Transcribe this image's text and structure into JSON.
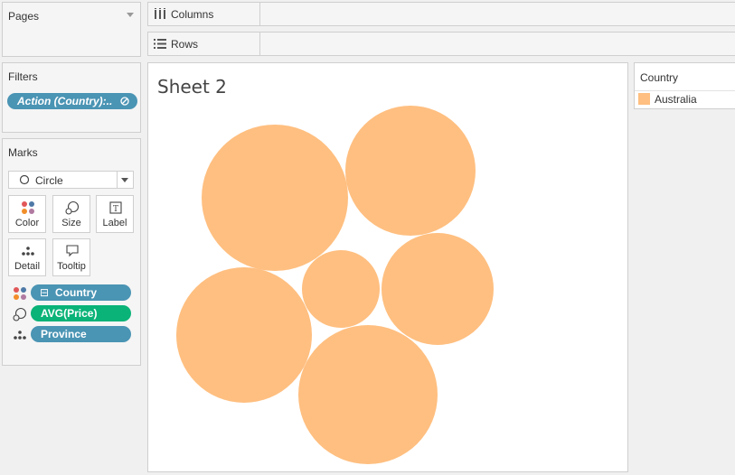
{
  "pages": {
    "title": "Pages"
  },
  "filters": {
    "title": "Filters",
    "pill_label": "Action (Country):.."
  },
  "marks": {
    "title": "Marks",
    "mark_type": "Circle",
    "buttons": {
      "color": "Color",
      "size": "Size",
      "label": "Label",
      "detail": "Detail",
      "tooltip": "Tooltip"
    },
    "cards": [
      {
        "label": "Country",
        "encoding": "color-icon",
        "prefix": "⊟"
      },
      {
        "label": "AVG(Price)",
        "encoding": "size-icon"
      },
      {
        "label": "Province",
        "encoding": "detail-icon"
      }
    ]
  },
  "shelves": {
    "columns": "Columns",
    "rows": "Rows"
  },
  "view": {
    "title": "Sheet 2",
    "mark_color": "#ffbf80"
  },
  "legend": {
    "title": "Country",
    "items": [
      {
        "label": "Australia",
        "color": "#ffbf80"
      }
    ]
  },
  "colors": {
    "pill_blue": "#4a94b4",
    "pill_green": "#0ab378",
    "mark": "#ffbf80"
  },
  "chart_data": {
    "type": "packed-bubble",
    "title": "Sheet 2",
    "color_by": "Country",
    "size_by": "AVG(Price)",
    "detail_by": "Province",
    "series": [
      {
        "name": "Australia",
        "bubble_count": 6
      }
    ],
    "relative_sizes": [
      1.0,
      0.88,
      0.93,
      0.77,
      0.54,
      0.96
    ]
  }
}
